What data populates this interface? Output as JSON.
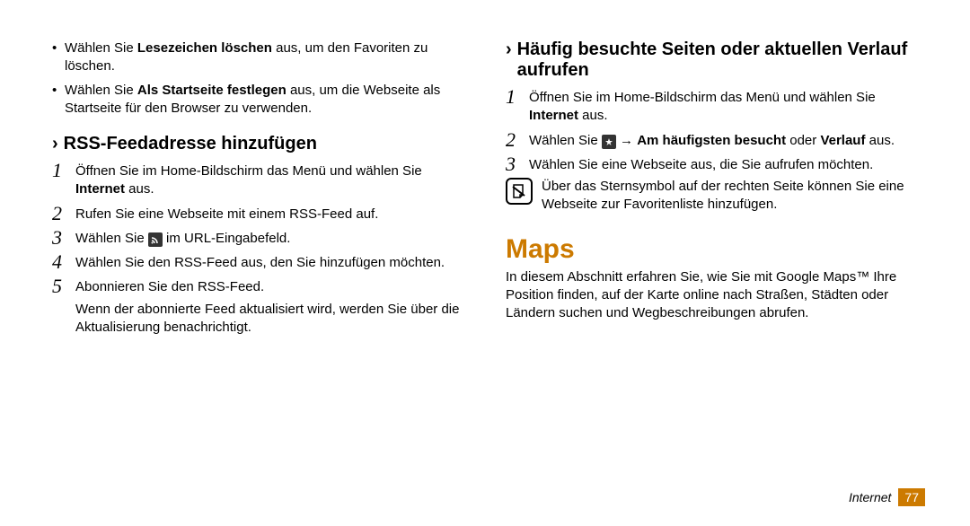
{
  "left": {
    "bullets": [
      {
        "pre": "Wählen Sie ",
        "bold": "Lesezeichen löschen",
        "post": " aus, um den Favoriten zu löschen."
      },
      {
        "pre": "Wählen Sie ",
        "bold": "Als Startseite festlegen",
        "post": " aus, um die Webseite als Startseite für den Browser zu verwenden."
      }
    ],
    "chevron": "›",
    "section_title": "RSS-Feedadresse hinzufügen",
    "steps": {
      "s1_num": "1",
      "s1_a": "Öffnen Sie im Home-Bildschirm das Menü und wählen Sie ",
      "s1_b": "Internet",
      "s1_c": " aus.",
      "s2_num": "2",
      "s2": "Rufen Sie eine Webseite mit einem RSS-Feed auf.",
      "s3_num": "3",
      "s3_a": "Wählen Sie ",
      "s3_b": " im URL-Eingabefeld.",
      "s4_num": "4",
      "s4": "Wählen Sie den RSS-Feed aus, den Sie hinzufügen möchten.",
      "s5_num": "5",
      "s5": "Abonnieren Sie den RSS-Feed.",
      "s5_extra": "Wenn der abonnierte Feed aktualisiert wird, werden Sie über die Aktualisierung benachrichtigt."
    }
  },
  "right": {
    "chevron": "›",
    "section_title": "Häufig besuchte Seiten oder aktuellen Verlauf aufrufen",
    "steps": {
      "s1_num": "1",
      "s1_a": "Öffnen Sie im Home-Bildschirm das Menü und wählen Sie ",
      "s1_b": "Internet",
      "s1_c": " aus.",
      "s2_num": "2",
      "s2_a": "Wählen Sie ",
      "s2_arrow": " → ",
      "s2_b": "Am häufigsten besucht",
      "s2_c": " oder ",
      "s2_d": "Verlauf",
      "s2_e": " aus.",
      "s3_num": "3",
      "s3": "Wählen Sie eine Webseite aus, die Sie aufrufen möchten."
    },
    "note": "Über das Sternsymbol auf der rechten Seite können Sie eine Webseite zur Favoritenliste hinzufügen.",
    "maps_title": "Maps",
    "maps_body": "In diesem Abschnitt erfahren Sie, wie Sie mit Google Maps™ Ihre Position finden, auf der Karte online nach Straßen, Städten oder Ländern suchen und Wegbeschreibungen abrufen."
  },
  "footer": {
    "label": "Internet",
    "page": "77"
  }
}
